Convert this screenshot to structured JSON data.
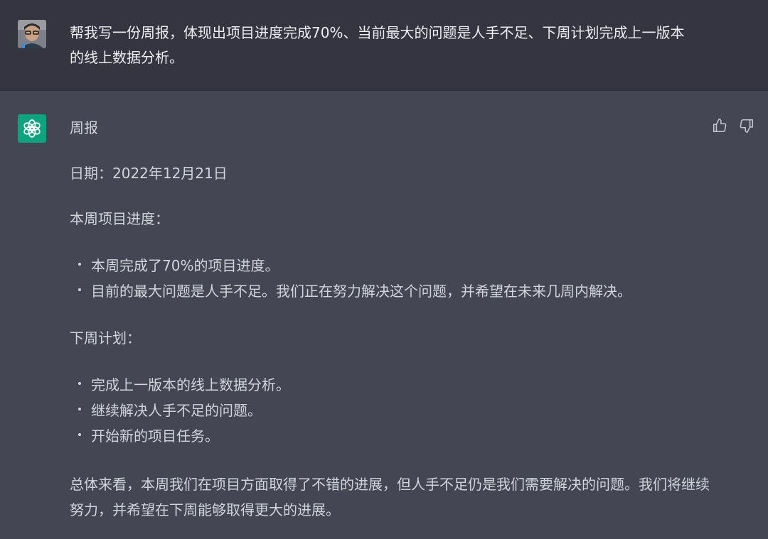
{
  "user_message": {
    "text": "帮我写一份周报，体现出项目进度完成70%、当前最大的问题是人手不足、下周计划完成上一版本的线上数据分析。"
  },
  "assistant_message": {
    "title": "周报",
    "date": "日期：2022年12月21日",
    "section_progress": {
      "heading": "本周项目进度：",
      "items": [
        "本周完成了70%的项目进度。",
        "目前的最大问题是人手不足。我们正在努力解决这个问题，并希望在未来几周内解决。"
      ]
    },
    "section_plan": {
      "heading": "下周计划：",
      "items": [
        "完成上一版本的线上数据分析。",
        "继续解决人手不足的问题。",
        "开始新的项目任务。"
      ]
    },
    "summary": "总体来看，本周我们在项目方面取得了不错的进展，但人手不足仍是我们需要解决的问题。我们将继续努力，并希望在下周能够取得更大的进展。"
  },
  "icons": {
    "user_avatar": "user-avatar-photo",
    "assistant_avatar": "openai-logo-icon",
    "thumbs_up": "thumbs-up-icon",
    "thumbs_down": "thumbs-down-icon"
  },
  "colors": {
    "user_bg": "#343541",
    "assistant_bg": "#444654",
    "brand": "#10a37f"
  }
}
